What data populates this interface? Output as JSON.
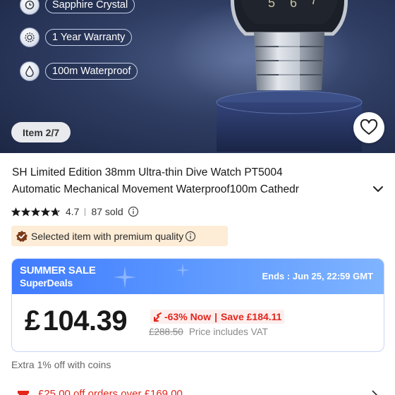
{
  "hero": {
    "features": [
      {
        "icon": "watch-face-icon",
        "label": "Sapphire Crystal"
      },
      {
        "icon": "gear-badge-icon",
        "label": "1 Year Warranty"
      },
      {
        "icon": "water-drop-icon",
        "label": "100m Waterproof"
      }
    ],
    "item_counter": "Item 2/7",
    "wishlist_icon": "heart-outline-icon"
  },
  "product": {
    "title_line1": "SH Limited Edition 38mm Ultra-thin Dive Watch PT5004",
    "title_line2": "Automatic Mechanical Movement Waterproof100m Cathedr",
    "rating": "4.7",
    "rating_stars": 4.7,
    "sold": "87 sold",
    "quality_badge": "Selected item with premium quality"
  },
  "sale": {
    "name_line1": "SUMMER SALE",
    "name_line2": "SuperDeals",
    "ends": "Ends : Jun 25, 22:59 GMT",
    "currency": "£",
    "price": "104.39",
    "discount": "-63% Now",
    "save": "Save £184.11",
    "old_price": "£288.50",
    "vat_note": "Price includes VAT"
  },
  "coins_note": "Extra 1% off with coins",
  "coupon": "£25.00 off orders over £169.00",
  "colors": {
    "accent_red": "#e4251b",
    "sale_blue": "#3f7bff",
    "badge_bg": "#fdecd6",
    "hero_bg": "#2f3d63"
  }
}
